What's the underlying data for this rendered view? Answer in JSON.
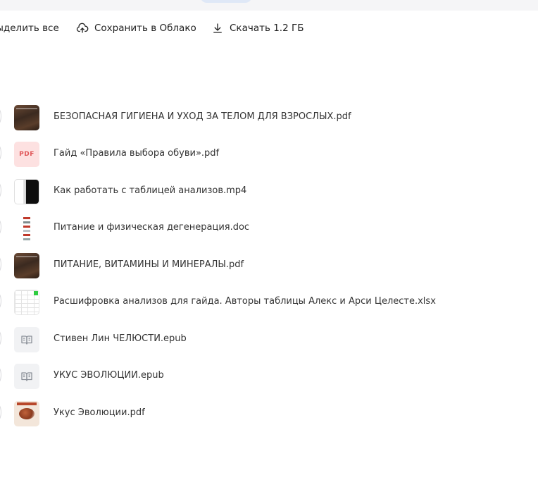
{
  "toolbar": {
    "select_all_label": "Выделить все",
    "save_to_cloud_label": "Сохранить в Облако",
    "download_label": "Скачать 1.2 ГБ",
    "icons": {
      "save_to_cloud": "cloud-upload-icon",
      "download": "download-icon"
    }
  },
  "files": [
    {
      "name": "БЕЗОПАСНАЯ ГИГИЕНА И УХОД ЗА ТЕЛОМ ДЛЯ ВЗРОСЛЫХ.pdf",
      "thumbnail": "book-cover-dark"
    },
    {
      "name": "Гайд «Правила выбора обуви».pdf",
      "thumbnail": "pdf-icon",
      "thumb_label": "PDF"
    },
    {
      "name": "Как работать с таблицей анализов.mp4",
      "thumbnail": "video-frame"
    },
    {
      "name": "Питание и физическая дегенерация.doc",
      "thumbnail": "document-page"
    },
    {
      "name": "ПИТАНИЕ, ВИТАМИНЫ И МИНЕРАЛЫ.pdf",
      "thumbnail": "book-cover-dark"
    },
    {
      "name": "Расшифровка анализов для гайда. Авторы таблицы Алекс и Арси Целесте.xlsx",
      "thumbnail": "spreadsheet"
    },
    {
      "name": "Стивен Лин ЧЕЛЮСТИ.epub",
      "thumbnail": "book-icon"
    },
    {
      "name": "УКУС ЭВОЛЮЦИИ.epub",
      "thumbnail": "book-icon"
    },
    {
      "name": "Укус Эволюции.pdf",
      "thumbnail": "book-cover-light"
    }
  ],
  "colors": {
    "pdf_badge_bg": "#fde1e1",
    "pdf_badge_text": "#e0585a",
    "epub_bg": "#f1f2f4",
    "text": "#333333"
  }
}
